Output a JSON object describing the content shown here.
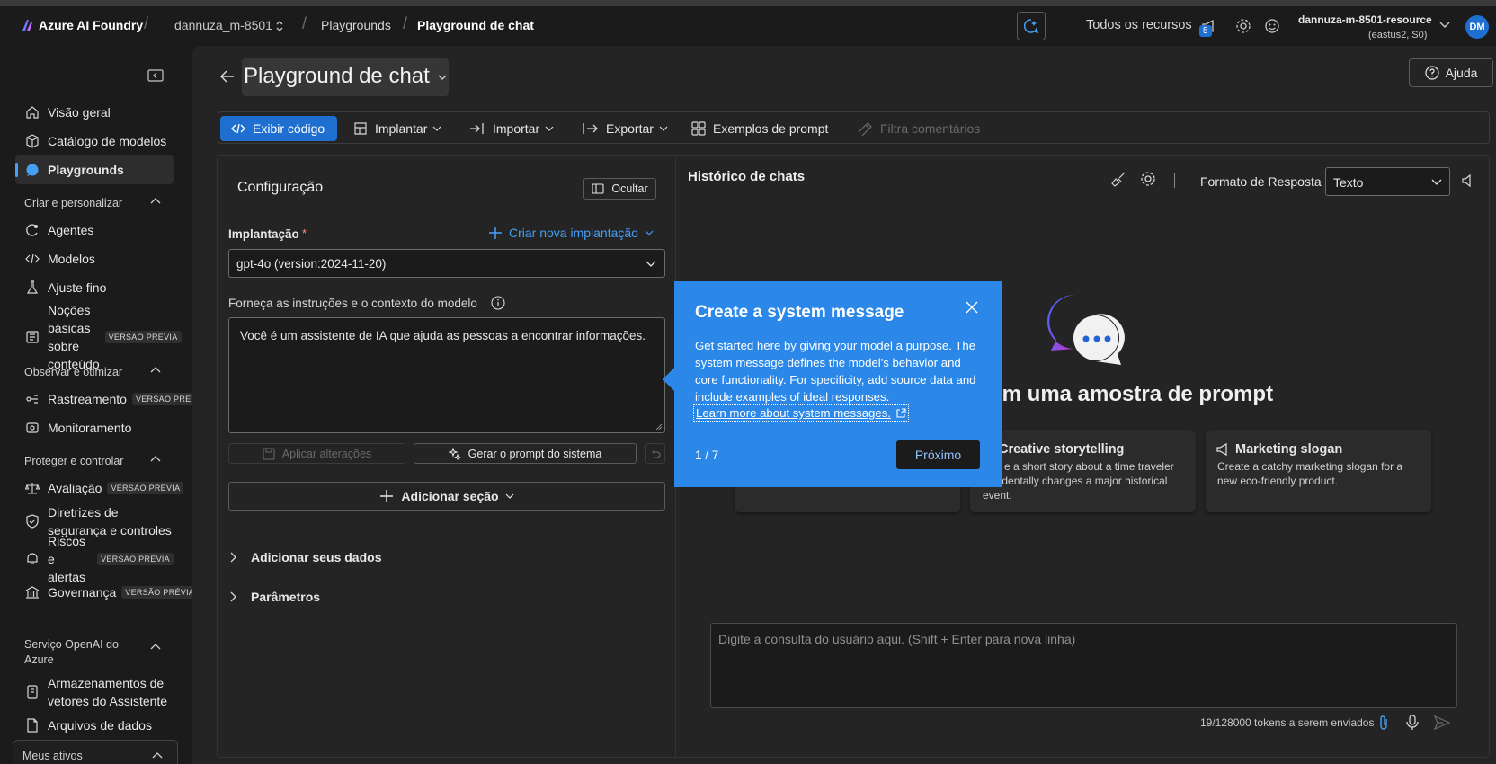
{
  "topbar": {
    "brand": "Azure AI Foundry",
    "project": "dannuza_m-8501",
    "crumb1": "Playgrounds",
    "crumb2": "Playground de chat",
    "all_resources": "Todos os recursos",
    "notif_count": "5",
    "resource_name": "dannuza-m-8501-resource",
    "resource_region": "(eastus2, S0)",
    "avatar": "DM"
  },
  "sidebar": {
    "items": [
      {
        "label": "Visão geral",
        "icon": "home-icon"
      },
      {
        "label": "Catálogo de modelos",
        "icon": "cube-icon"
      },
      {
        "label": "Playgrounds",
        "icon": "chat-icon"
      }
    ],
    "section1": "Criar e personalizar",
    "s1_items": [
      {
        "label": "Agentes"
      },
      {
        "label": "Modelos"
      },
      {
        "label": "Ajuste fino"
      },
      {
        "label": "Noções básicas sobre conteúdo",
        "badge": "VERSÃO PRÉVIA"
      }
    ],
    "section2": "Observar e otimizar",
    "s2_items": [
      {
        "label": "Rastreamento",
        "badge": "VERSÃO PRÉ"
      },
      {
        "label": "Monitoramento"
      }
    ],
    "section3": "Proteger e controlar",
    "s3_items": [
      {
        "label": "Avaliação",
        "badge": "VERSÃO PRÉVIA"
      },
      {
        "label": "Diretrizes de segurança e controles"
      },
      {
        "label": "Riscos e alertas",
        "badge": "VERSÃO PRÉVIA"
      },
      {
        "label": "Governança",
        "badge": "VERSÃO PRÉVIA"
      }
    ],
    "section4": "Serviço OpenAI do Azure",
    "s4_items": [
      {
        "label": "Armazenamentos de vetores do Assistente"
      },
      {
        "label": "Arquivos de dados"
      }
    ],
    "section5": "Meus ativos"
  },
  "page": {
    "title": "Playground de chat",
    "help": "Ajuda"
  },
  "toolbar": {
    "view_code": "Exibir código",
    "deploy": "Implantar",
    "import": "Importar",
    "export": "Exportar",
    "prompt_examples": "Exemplos de prompt",
    "filter_comments": "Filtra comentários"
  },
  "config": {
    "title": "Configuração",
    "hide": "Ocultar",
    "deployment_label": "Implantação",
    "required_mark": "*",
    "create_deployment": "Criar nova implantação",
    "deployment_value": "gpt-4o (version:2024-11-20)",
    "instructions_label": "Forneça as instruções e o contexto do modelo",
    "system_message": "Você é um assistente de IA que ajuda as pessoas a encontrar informações.",
    "apply_changes": "Aplicar alterações",
    "generate_prompt": "Gerar o prompt do sistema",
    "add_section": "Adicionar seção",
    "add_data": "Adicionar seus dados",
    "parameters": "Parâmetros"
  },
  "chat": {
    "history": "Histórico de chats",
    "response_format_label": "Formato de Resposta",
    "response_format_value": "Texto",
    "sample_heading": "om uma amostra de prompt",
    "cards": [
      {
        "title": "",
        "desc": ""
      },
      {
        "title": "Creative storytelling",
        "desc": "e a short story about a time traveler accidentally changes a major historical event."
      },
      {
        "title": "Marketing slogan",
        "desc": "Create a catchy marketing slogan for a new eco-friendly product."
      }
    ],
    "input_placeholder": "Digite a consulta do usuário aqui. (Shift + Enter para nova linha)",
    "tokens": "19/128000 tokens a serem enviados"
  },
  "popup": {
    "title": "Create a system message",
    "body": "Get started here by giving your model a purpose. The system message defines the model's behavior and core functionality. For specificity, add source data and include examples of ideal responses.",
    "link": "Learn more about system messages.",
    "step": "1 / 7",
    "next": "Próximo"
  },
  "colors": {
    "accent": "#1f6fd1",
    "popup": "#2b88e8",
    "link": "#479ef5"
  }
}
